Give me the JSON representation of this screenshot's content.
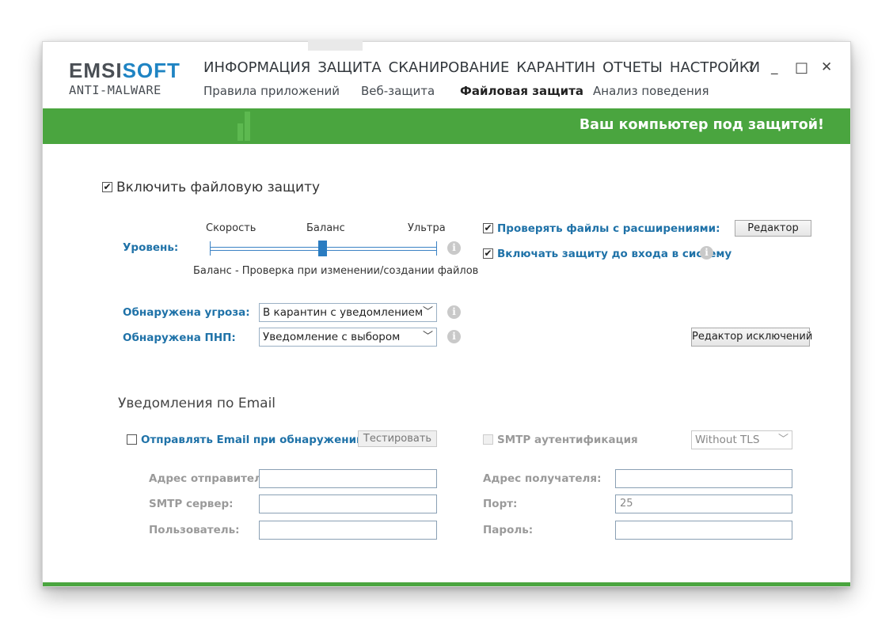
{
  "logo": {
    "part1": "EMSI",
    "part2": "SOFT",
    "sub": "ANTI-MALWARE"
  },
  "mainnav": [
    "ИНФОРМАЦИЯ",
    "ЗАЩИТА",
    "СКАНИРОВАНИЕ",
    "КАРАНТИН",
    "ОТЧЕТЫ",
    "НАСТРОЙКИ"
  ],
  "subnav": [
    "Правила приложений",
    "Веб-защита",
    "Файловая защита",
    "Анализ поведения"
  ],
  "subnav_active": "Файловая защита",
  "window_controls": {
    "help": "?",
    "minimize": "_",
    "maximize": "□",
    "close": "✕"
  },
  "status": "Ваш компьютер под защитой!",
  "file_protection": {
    "enable_label": "Включить файловую защиту",
    "enable_checked": true,
    "level_label": "Уровень:",
    "level_options": [
      "Скорость",
      "Баланс",
      "Ультра"
    ],
    "level_selected": "Баланс",
    "level_description": "Баланс - Проверка при изменении/создании файлов",
    "check_ext_label": "Проверять файлы с расширениями:",
    "check_ext_checked": true,
    "editor_button": "Редактор",
    "preboot_label": "Включать защиту до входа в систему",
    "preboot_checked": true,
    "threat_label": "Обнаружена угроза:",
    "threat_value": "В карантин с уведомлением",
    "pup_label": "Обнаружена ПНП:",
    "pup_value": "Уведомление с выбором",
    "exclusions_button": "Редактор исключений"
  },
  "email": {
    "title": "Уведомления по Email",
    "send_label": "Отправлять Email при обнаружении",
    "send_checked": false,
    "test_button": "Тестировать",
    "smtp_auth_label": "SMTP аутентификация",
    "tls_value": "Without TLS",
    "sender_label": "Адрес отправителя:",
    "sender_value": "",
    "smtp_server_label": "SMTP сервер:",
    "smtp_server_value": "",
    "user_label": "Пользователь:",
    "user_value": "",
    "recipient_label": "Адрес получателя:",
    "recipient_value": "",
    "port_label": "Порт:",
    "port_value": "25",
    "password_label": "Пароль:",
    "password_value": ""
  },
  "colors": {
    "accent_green": "#4aa53f",
    "brand_blue": "#1f84c3",
    "label_blue": "#1f72a8"
  }
}
